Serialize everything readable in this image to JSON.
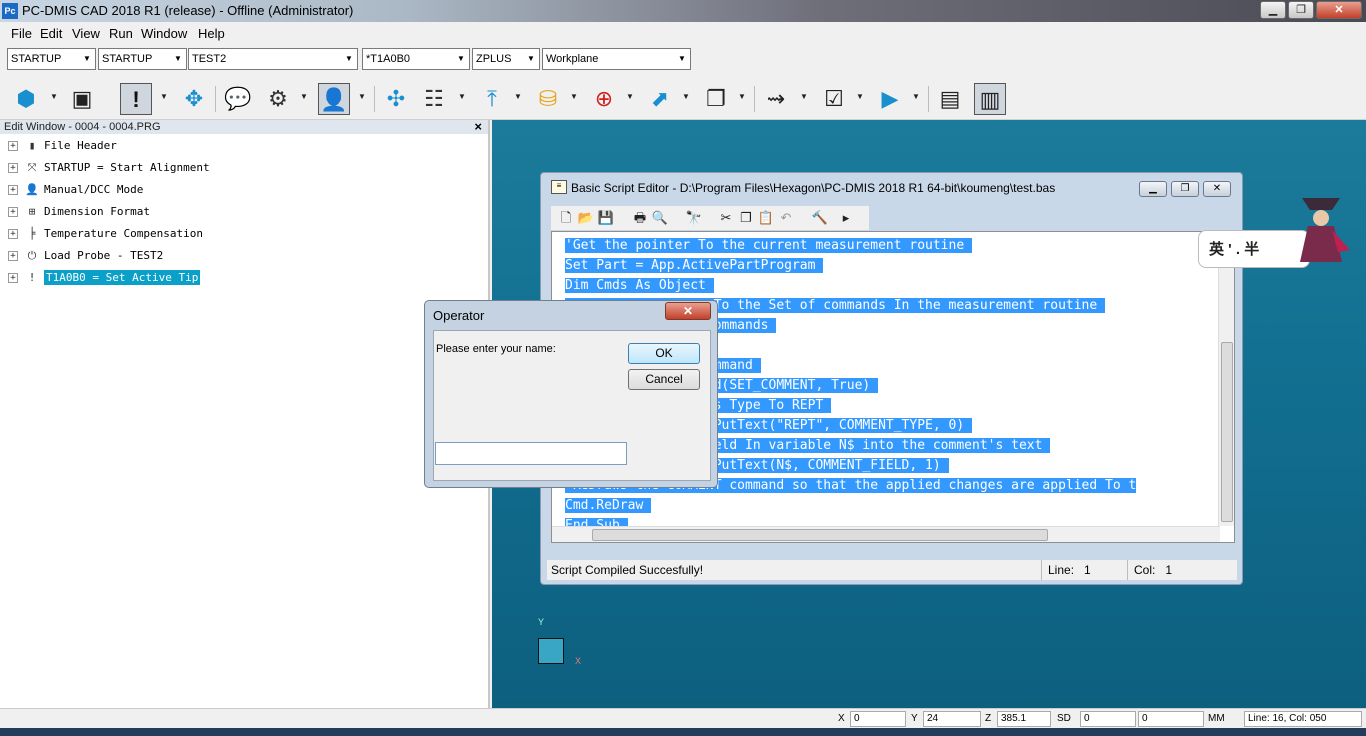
{
  "window": {
    "logo": "Pc",
    "title": "PC-DMIS CAD 2018 R1 (release) - Offline (Administrator)",
    "min": "▁",
    "max": "❐",
    "close": "✕"
  },
  "menu": [
    "File",
    "Edit",
    "View",
    "Run",
    "Window",
    "Help"
  ],
  "combos": [
    "STARTUP",
    "STARTUP",
    "TEST2",
    "*T1A0B0",
    "ZPLUS",
    "Workplane"
  ],
  "edit_window": {
    "title": "Edit Window - 0004 - 0004.PRG",
    "close": "×",
    "items": [
      {
        "label": "File Header",
        "icon": "file-header-icon"
      },
      {
        "label": "STARTUP = Start Alignment",
        "icon": "alignment-icon"
      },
      {
        "label": "Manual/DCC Mode",
        "icon": "mode-icon"
      },
      {
        "label": "Dimension Format",
        "icon": "dimension-format-icon"
      },
      {
        "label": "Temperature Compensation",
        "icon": "thermometer-icon"
      },
      {
        "label": "Load Probe - TEST2",
        "icon": "probe-icon"
      },
      {
        "label": "T1A0B0 = Set Active Tip",
        "icon": "tip-icon"
      }
    ]
  },
  "script_editor": {
    "title": "Basic Script Editor - D:\\Program Files\\Hexagon\\PC-DMIS 2018 R1 64-bit\\koumeng\\test.bas",
    "code_lines": [
      "'Get the pointer To the current measurement routine ",
      "Set Part = App.ActivePartProgram ",
      "Dim Cmds As Object ",
      "                   To the Set of commands In the measurement routine ",
      "                   ommands ",
      "",
      "                   mmand ",
      "                   d(SET_COMMENT, True) ",
      "                   s Type To REPT ",
      "                   PutText(\"REPT\", COMMENT_TYPE, 0) ",
      "                   eld In variable N$ into the comment's text ",
      "                   PutText(N$, COMMENT_FIELD, 1) ",
      "'ReDraws the COMMENT command so that the applied changes are applied To t",
      "Cmd.ReDraw ",
      "End Sub "
    ],
    "status": "Script Compiled Succesfully!",
    "line_label": "Line:",
    "line_value": "1",
    "col_label": "Col:",
    "col_value": "1"
  },
  "operator_dialog": {
    "title": "Operator",
    "prompt": "Please enter your name:",
    "ok": "OK",
    "cancel": "Cancel",
    "input_value": ""
  },
  "floating_badge": "英 ' . 半",
  "axes": {
    "y": "Y",
    "x": "X"
  },
  "statusbar": {
    "x_label": "X",
    "x_value": "0",
    "y_label": "Y",
    "y_value": "24",
    "z_label": "Z",
    "z_value": "385.1",
    "sd_label": "SD",
    "sd_value": "0",
    "extra_value": "0",
    "mm": "MM",
    "line_col": "Line: 16, Col: 050"
  }
}
